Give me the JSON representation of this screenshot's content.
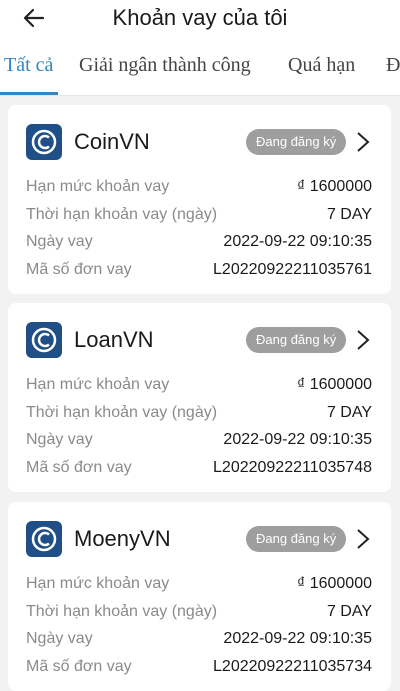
{
  "header": {
    "title": "Khoản vay của tôi"
  },
  "tabs": [
    {
      "label": "Tất cả",
      "active": true
    },
    {
      "label": "Giải ngân thành công",
      "active": false
    },
    {
      "label": "Quá hạn",
      "active": false
    },
    {
      "label": "Đ",
      "active": false
    }
  ],
  "colors": {
    "accent": "#2f86c6",
    "badge": "#9e9e9e",
    "logo": "#1f4f86"
  },
  "icons": {
    "back": "arrow-left-icon",
    "chevron": "chevron-right-icon",
    "logo": "coin-logo-icon"
  },
  "loans": [
    {
      "name": "CoinVN",
      "status": "Đang đăng ký",
      "fields": [
        {
          "label": "Hạn mức khoản vay",
          "value": "₫ 1600000"
        },
        {
          "label": "Thời hạn khoản vay (ngày)",
          "value": "7 DAY"
        },
        {
          "label": "Ngày vay",
          "value": "2022-09-22 09:10:35"
        },
        {
          "label": "Mã số đơn vay",
          "value": "L20220922211035761"
        }
      ]
    },
    {
      "name": "LoanVN",
      "status": "Đang đăng ký",
      "fields": [
        {
          "label": "Hạn mức khoản vay",
          "value": "₫ 1600000"
        },
        {
          "label": "Thời hạn khoản vay (ngày)",
          "value": "7 DAY"
        },
        {
          "label": "Ngày vay",
          "value": "2022-09-22 09:10:35"
        },
        {
          "label": "Mã số đơn vay",
          "value": "L20220922211035748"
        }
      ]
    },
    {
      "name": "MoenyVN",
      "status": "Đang đăng ký",
      "fields": [
        {
          "label": "Hạn mức khoản vay",
          "value": "₫ 1600000"
        },
        {
          "label": "Thời hạn khoản vay (ngày)",
          "value": "7 DAY"
        },
        {
          "label": "Ngày vay",
          "value": "2022-09-22 09:10:35"
        },
        {
          "label": "Mã số đơn vay",
          "value": "L20220922211035734"
        }
      ]
    }
  ]
}
